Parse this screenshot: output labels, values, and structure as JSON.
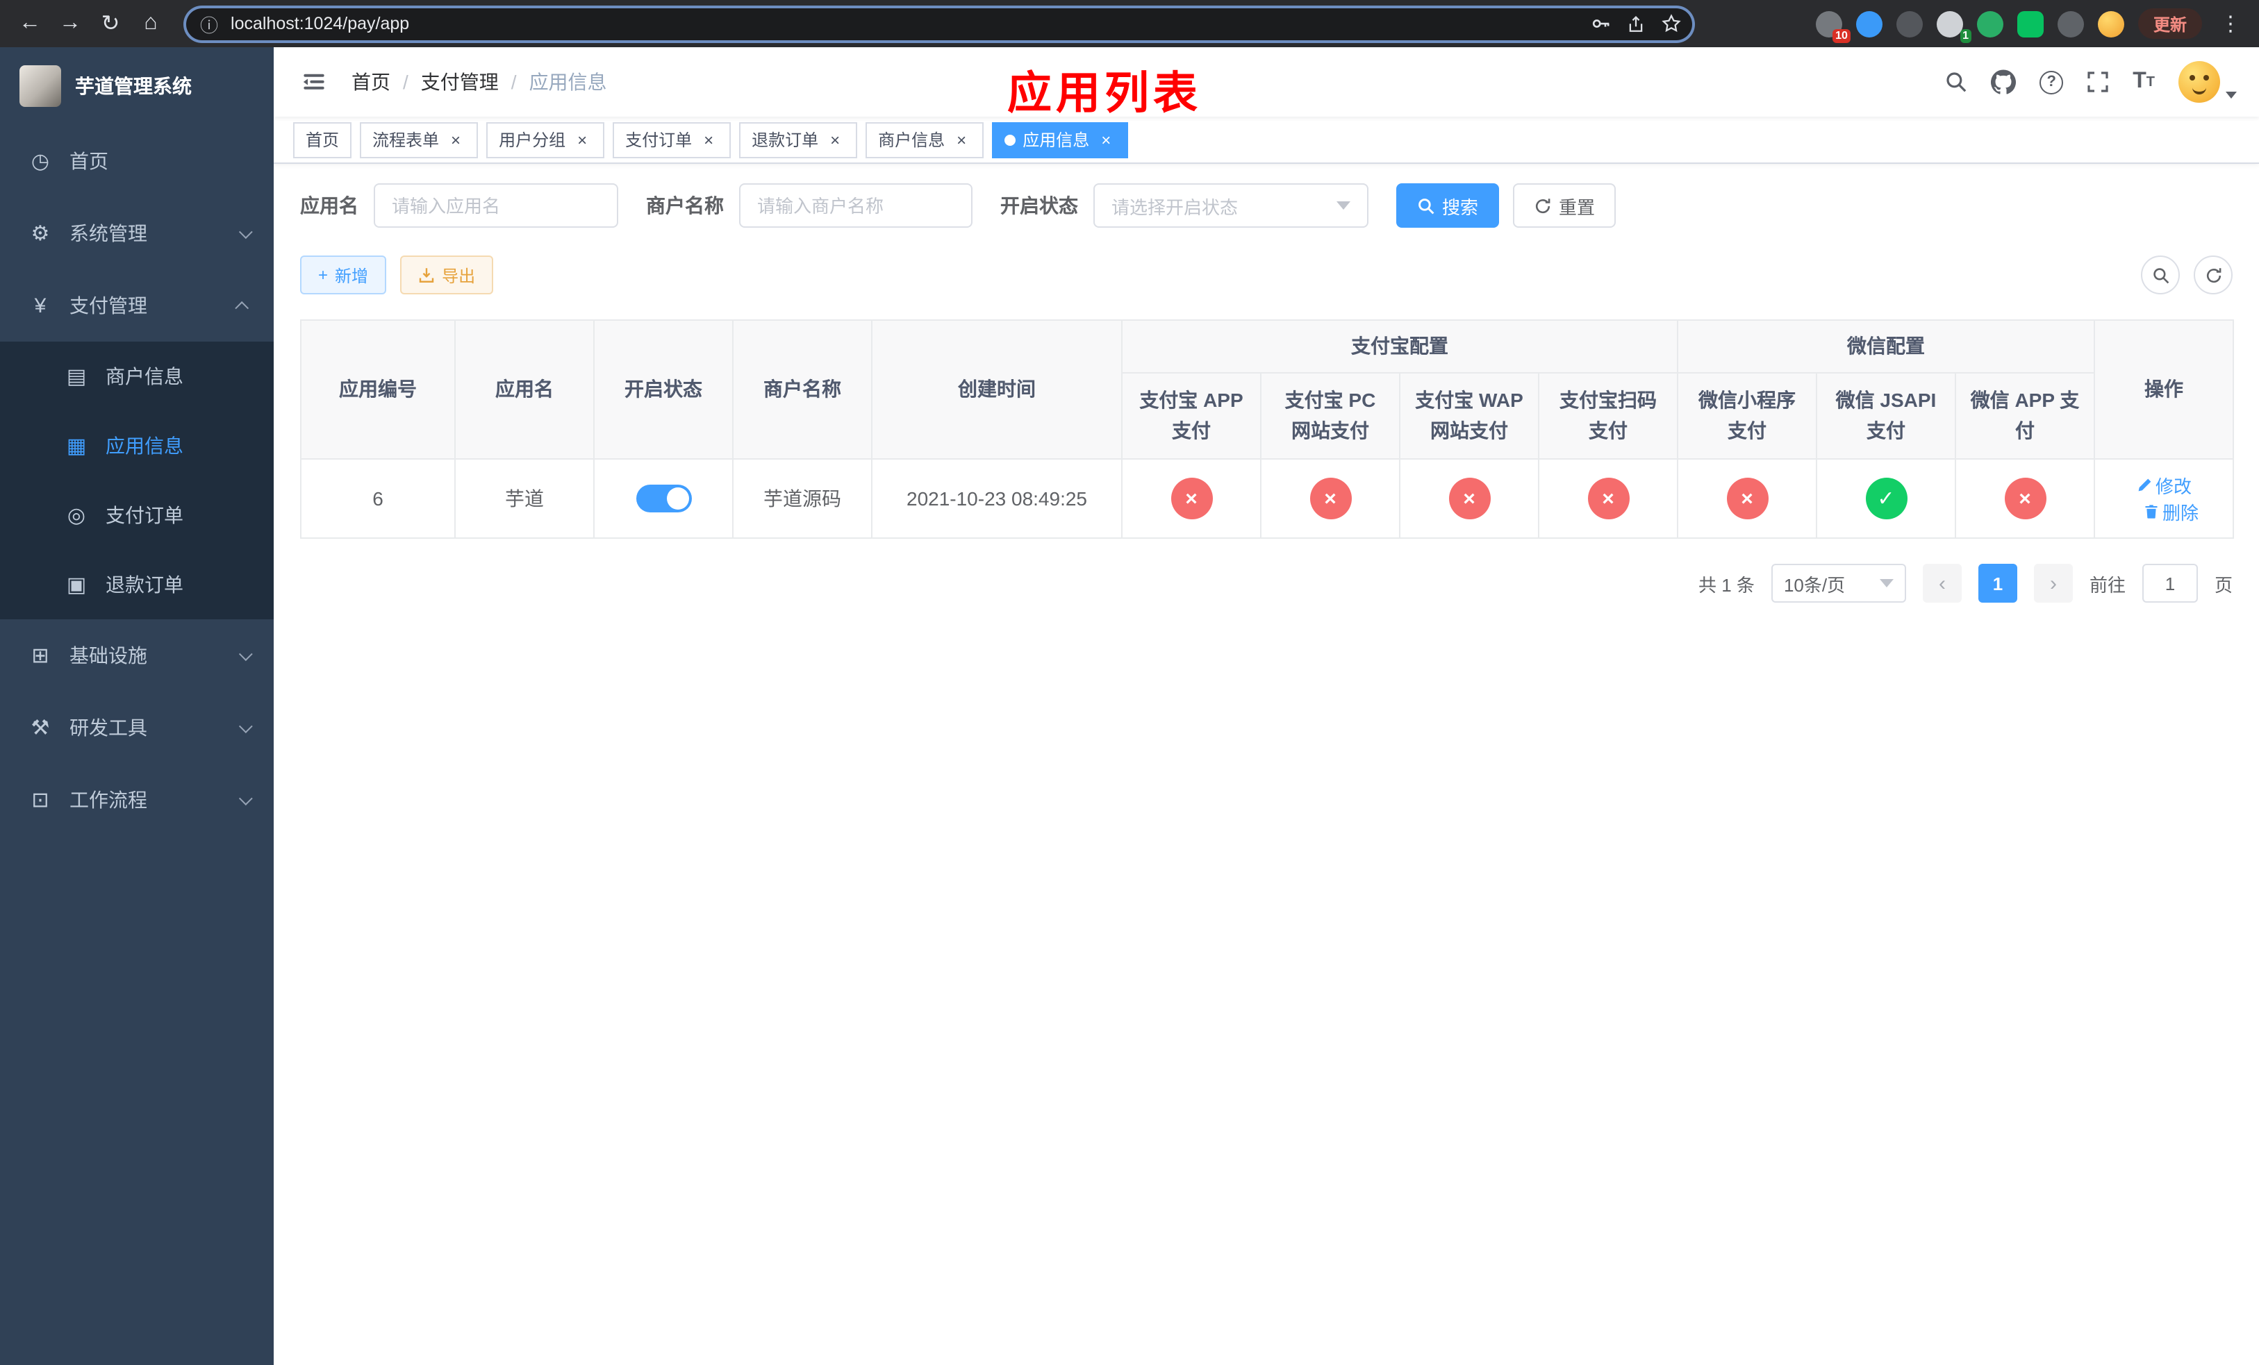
{
  "colors": {
    "accent": "#409EFF",
    "success": "#13ce66",
    "danger": "#f56c6c",
    "warning": "#e6a23c",
    "annotation": "#ff0000",
    "sidebar_bg": "#304156",
    "sidebar_submenu_bg": "#1f2d3d"
  },
  "browser": {
    "url": "localhost:1024/pay/app",
    "update_button": "更新",
    "extensions": [
      {
        "name": "extension-1",
        "badge": "10"
      },
      {
        "name": "extension-2",
        "badge": ""
      },
      {
        "name": "extension-3",
        "badge": ""
      },
      {
        "name": "extension-4",
        "badge": "1"
      },
      {
        "name": "extension-5",
        "badge": ""
      },
      {
        "name": "extension-6",
        "badge": ""
      },
      {
        "name": "extension-7",
        "badge": ""
      },
      {
        "name": "profile-avatar",
        "badge": ""
      }
    ]
  },
  "sidebar": {
    "title": "芋道管理系统",
    "items": [
      {
        "label": "首页"
      },
      {
        "label": "系统管理"
      },
      {
        "label": "支付管理"
      },
      {
        "label": "商户信息"
      },
      {
        "label": "应用信息"
      },
      {
        "label": "支付订单"
      },
      {
        "label": "退款订单"
      },
      {
        "label": "基础设施"
      },
      {
        "label": "研发工具"
      },
      {
        "label": "工作流程"
      }
    ]
  },
  "navbar": {
    "breadcrumb": [
      "首页",
      "支付管理",
      "应用信息"
    ],
    "annotation": "应用列表"
  },
  "tabs": [
    {
      "label": "首页",
      "closable": false,
      "active": false
    },
    {
      "label": "流程表单",
      "closable": true,
      "active": false
    },
    {
      "label": "用户分组",
      "closable": true,
      "active": false
    },
    {
      "label": "支付订单",
      "closable": true,
      "active": false
    },
    {
      "label": "退款订单",
      "closable": true,
      "active": false
    },
    {
      "label": "商户信息",
      "closable": true,
      "active": false
    },
    {
      "label": "应用信息",
      "closable": true,
      "active": true
    }
  ],
  "filters": {
    "app_name": {
      "label": "应用名",
      "placeholder": "请输入应用名",
      "value": ""
    },
    "merchant_name": {
      "label": "商户名称",
      "placeholder": "请输入商户名称",
      "value": ""
    },
    "status": {
      "label": "开启状态",
      "placeholder": "请选择开启状态",
      "value": ""
    },
    "search_button": "搜索",
    "reset_button": "重置"
  },
  "toolbar": {
    "add_button": "新增",
    "export_button": "导出"
  },
  "table": {
    "columns": {
      "id": "应用编号",
      "name": "应用名",
      "status": "开启状态",
      "merchant": "商户名称",
      "created": "创建时间",
      "alipay_group": "支付宝配置",
      "wechat_group": "微信配置",
      "alipay_app": "支付宝 APP 支付",
      "alipay_pc": "支付宝 PC 网站支付",
      "alipay_wap": "支付宝 WAP 网站支付",
      "alipay_qr": "支付宝扫码支付",
      "wx_lite": "微信小程序支付",
      "wx_jsapi": "微信 JSAPI 支付",
      "wx_app": "微信 APP 支付",
      "actions": "操作"
    },
    "rows": [
      {
        "id": "6",
        "name": "芋道",
        "status_on": true,
        "merchant": "芋道源码",
        "created": "2021-10-23 08:49:25",
        "configs": [
          "no",
          "no",
          "no",
          "no",
          "no",
          "yes",
          "no"
        ],
        "edit_label": "修改",
        "delete_label": "删除"
      }
    ]
  },
  "pagination": {
    "total": "共 1 条",
    "page_size": "10条/页",
    "current_page": "1",
    "goto_prefix": "前往",
    "goto_value": "1",
    "goto_suffix": "页"
  }
}
